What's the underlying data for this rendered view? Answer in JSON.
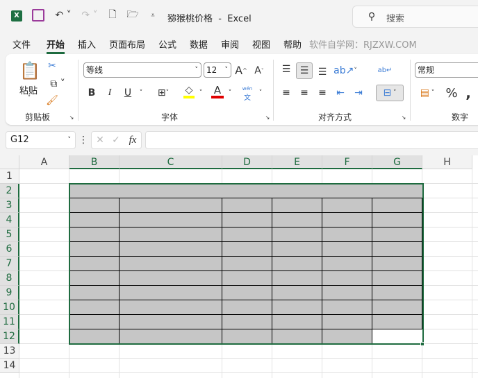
{
  "titlebar": {
    "doc_title": "猕猴桃价格",
    "sep": "-",
    "app": "Excel",
    "search_placeholder": "搜索"
  },
  "tabs": [
    "文件",
    "开始",
    "插入",
    "页面布局",
    "公式",
    "数据",
    "审阅",
    "视图",
    "帮助"
  ],
  "watermark": "软件自学网：RJZXW.COM",
  "ribbon": {
    "paste": "粘贴",
    "clipboard": "剪贴板",
    "font_name": "等线",
    "font_size": "12",
    "font": "字体",
    "alignment": "对齐方式",
    "number_format": "常规",
    "number": "数字",
    "bold": "B",
    "italic": "I",
    "underline": "U",
    "font_color_letter": "A",
    "grow": "A",
    "shrink": "A",
    "phonetic": "wén"
  },
  "formula_bar": {
    "name_box": "G12",
    "fx": "fx",
    "value": ""
  },
  "columns": [
    "A",
    "B",
    "C",
    "D",
    "E",
    "F",
    "G",
    "H"
  ],
  "rows": [
    "1",
    "2",
    "3",
    "4",
    "5",
    "6",
    "7",
    "8",
    "9",
    "10",
    "11",
    "12",
    "13",
    "14"
  ],
  "colors": {
    "accent": "#1e6b3f",
    "cell_fill": "#c6c6c6"
  }
}
